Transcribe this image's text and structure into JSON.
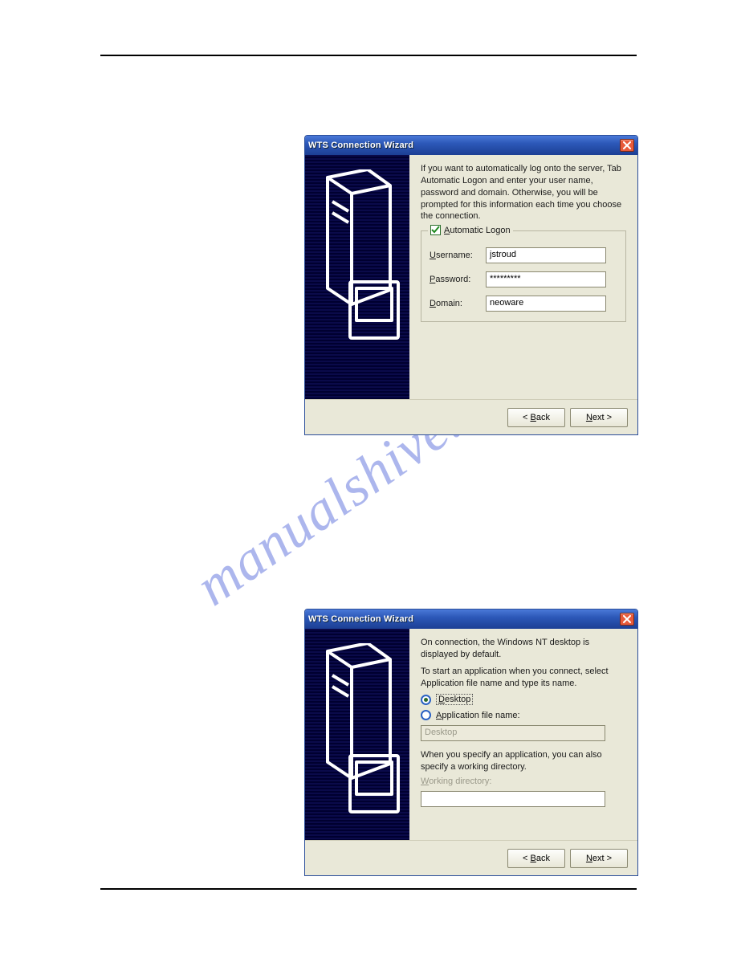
{
  "watermark": "manualshive.com",
  "dialog1": {
    "title": "WTS Connection Wizard",
    "intro": "If you want to automatically log onto the server, Tab Automatic Logon and enter your user name, password and domain. Otherwise, you will be prompted for this information each time you choose the connection.",
    "autologon_label_prefix": "A",
    "autologon_label_rest": "utomatic Logon",
    "username_prefix": "U",
    "username_rest": "sername:",
    "username_value": "jstroud",
    "password_prefix": "P",
    "password_rest": "assword:",
    "password_value": "*********",
    "domain_prefix": "D",
    "domain_rest": "omain:",
    "domain_value": "neoware",
    "back_label": "< Back",
    "next_label": "Next >"
  },
  "dialog2": {
    "title": "WTS Connection Wizard",
    "intro1": "On connection, the Windows NT desktop is displayed by default.",
    "intro2": "To start an application when you connect, select Application file name and type its name.",
    "desktop_prefix": "D",
    "desktop_rest": "esktop",
    "appfile_prefix": "A",
    "appfile_rest": "pplication file name:",
    "appfile_value": "Desktop",
    "specify_text": "When you specify an application, you can also specify a working directory.",
    "workdir_prefix": "W",
    "workdir_rest": "orking directory:",
    "workdir_value": "",
    "back_label": "< Back",
    "next_label": "Next >"
  }
}
